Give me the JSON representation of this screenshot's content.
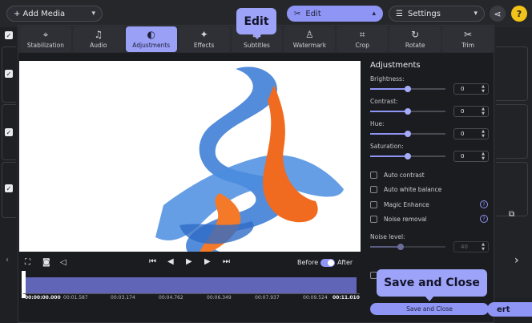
{
  "topbar": {
    "add_media": "+ Add Media",
    "edit": "Edit",
    "settings": "Settings",
    "help": "?"
  },
  "callouts": {
    "edit": "Edit",
    "save": "Save and Close"
  },
  "tabs": [
    {
      "label": "Stabilization",
      "icon": "stabilization-icon"
    },
    {
      "label": "Audio",
      "icon": "music-note-icon"
    },
    {
      "label": "Adjustments",
      "icon": "contrast-icon"
    },
    {
      "label": "Effects",
      "icon": "magic-wand-icon"
    },
    {
      "label": "Subtitles",
      "icon": "subtitles-icon"
    },
    {
      "label": "Watermark",
      "icon": "stamp-icon"
    },
    {
      "label": "Crop",
      "icon": "crop-icon"
    },
    {
      "label": "Rotate",
      "icon": "rotate-icon"
    },
    {
      "label": "Trim",
      "icon": "scissors-icon"
    }
  ],
  "player": {
    "before": "Before",
    "after": "After"
  },
  "timeline": {
    "labels": [
      "00:00:00.000",
      "00:01.587",
      "00:03.174",
      "00:04.762",
      "00:06.349",
      "00:07.937",
      "00:09.524",
      "00:11.010"
    ]
  },
  "panel": {
    "title": "Adjustments",
    "brightness": {
      "label": "Brightness:",
      "value": "0",
      "level": 0.5
    },
    "contrast": {
      "label": "Contrast:",
      "value": "0",
      "level": 0.5
    },
    "hue": {
      "label": "Hue:",
      "value": "0",
      "level": 0.5
    },
    "saturation": {
      "label": "Saturation:",
      "value": "0",
      "level": 0.5
    },
    "auto_contrast": "Auto contrast",
    "auto_white_balance": "Auto white balance",
    "magic_enhance": "Magic Enhance",
    "noise_removal": "Noise removal",
    "noise_level": {
      "label": "Noise level:",
      "value": "40",
      "level": 0.4
    },
    "save_button": "Save and Close"
  },
  "background": {
    "convert_partial": "ert"
  },
  "colors": {
    "accent": "#8f95f4",
    "orange": "#f06a1f",
    "blue": "#3f7fd6"
  }
}
